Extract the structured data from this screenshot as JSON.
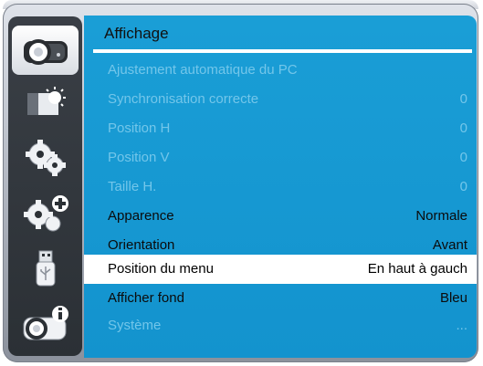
{
  "menu": {
    "title": "Affichage",
    "items": [
      {
        "label": "Ajustement automatique du PC",
        "value": "",
        "state": "disabled"
      },
      {
        "label": "Synchronisation correcte",
        "value": "0",
        "state": "disabled"
      },
      {
        "label": "Position H",
        "value": "0",
        "state": "disabled"
      },
      {
        "label": "Position V",
        "value": "0",
        "state": "disabled"
      },
      {
        "label": "Taille H.",
        "value": "0",
        "state": "disabled"
      },
      {
        "label": "Apparence",
        "value": "Normale",
        "state": "enabled"
      },
      {
        "label": "Orientation",
        "value": "Avant",
        "state": "enabled"
      },
      {
        "label": "Position du menu",
        "value": "En haut à gauch",
        "state": "selected"
      },
      {
        "label": "Afficher fond",
        "value": "Bleu",
        "state": "enabled"
      },
      {
        "label": "Système",
        "value": "...",
        "state": "disabled"
      }
    ]
  },
  "sidebar": {
    "icons": [
      "projector-display-icon",
      "picture-brightness-icon",
      "settings-gear-icon",
      "extended-settings-icon",
      "usb-icon",
      "projector-info-icon"
    ],
    "active_index": 0
  },
  "colors": {
    "panel_blue": "#1393ce",
    "disabled_text": "#73c6ea",
    "sidebar_bg": "#2b3035"
  }
}
